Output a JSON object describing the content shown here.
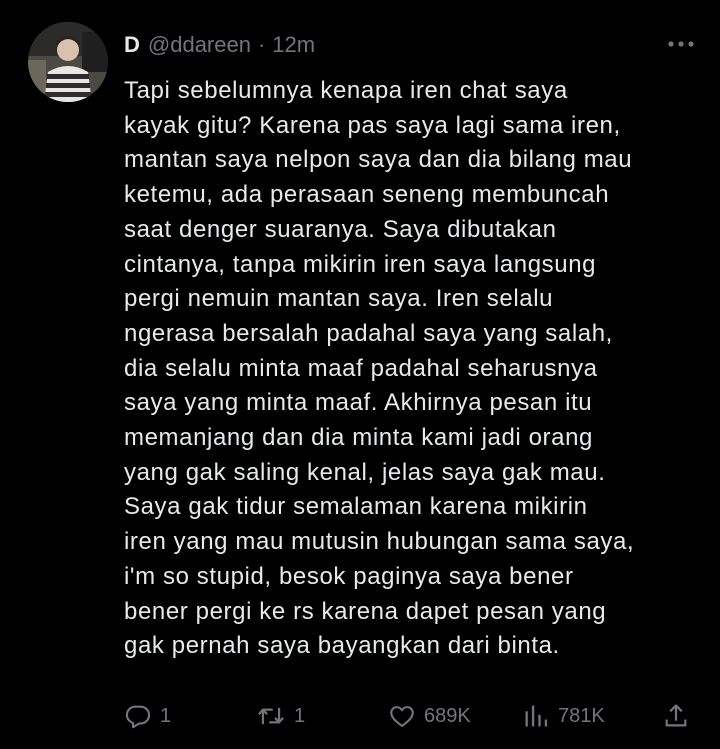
{
  "tweet": {
    "author": {
      "display_name": "D",
      "handle": "@ddareen",
      "separator": "·",
      "timestamp": "12m"
    },
    "text_lines": [
      "Tapi sebelumnya kenapa iren chat saya",
      "kayak gitu? Karena pas saya lagi sama iren,",
      "mantan saya nelpon saya dan dia bilang mau",
      "ketemu, ada perasaan seneng membuncah",
      "saat denger suaranya. Saya dibutakan",
      "cintanya, tanpa mikirin iren saya langsung",
      "pergi nemuin mantan saya. Iren selalu",
      "ngerasa bersalah padahal saya yang salah,",
      "dia selalu minta maaf padahal seharusnya",
      "saya yang minta maaf. Akhirnya pesan itu",
      "memanjang dan dia minta kami jadi orang",
      "yang gak saling kenal, jelas saya gak mau.",
      "Saya gak tidur semalaman karena mikirin",
      "iren yang mau mutusin hubungan sama saya,",
      "i'm so stupid, besok paginya saya bener",
      "bener pergi ke rs karena dapet pesan yang",
      "gak pernah saya bayangkan dari binta."
    ],
    "actions": {
      "replies": "1",
      "reposts": "1",
      "likes": "689K",
      "views": "781K"
    },
    "icons": {
      "more": "more-horizontal-icon",
      "reply": "reply-bubble-icon",
      "repost": "repost-arrows-icon",
      "like": "heart-icon",
      "views": "bar-chart-icon",
      "share": "share-upload-icon"
    },
    "colors": {
      "background": "#000000",
      "primary_text": "#e7e9ea",
      "secondary_text": "#71767b"
    }
  }
}
